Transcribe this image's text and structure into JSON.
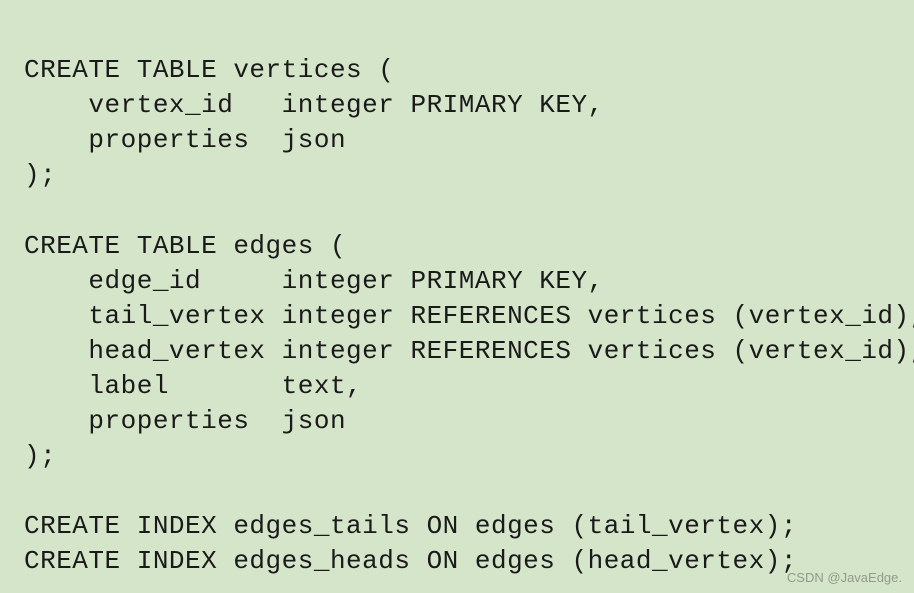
{
  "code": {
    "line1": "CREATE TABLE vertices (",
    "line2": "    vertex_id   integer PRIMARY KEY,",
    "line3": "    properties  json",
    "line4": ");",
    "line5": "",
    "line6": "CREATE TABLE edges (",
    "line7": "    edge_id     integer PRIMARY KEY,",
    "line8": "    tail_vertex integer REFERENCES vertices (vertex_id),",
    "line9": "    head_vertex integer REFERENCES vertices (vertex_id),",
    "line10": "    label       text,",
    "line11": "    properties  json",
    "line12": ");",
    "line13": "",
    "line14": "CREATE INDEX edges_tails ON edges (tail_vertex);",
    "line15": "CREATE INDEX edges_heads ON edges (head_vertex);"
  },
  "watermark": "CSDN @JavaEdge."
}
